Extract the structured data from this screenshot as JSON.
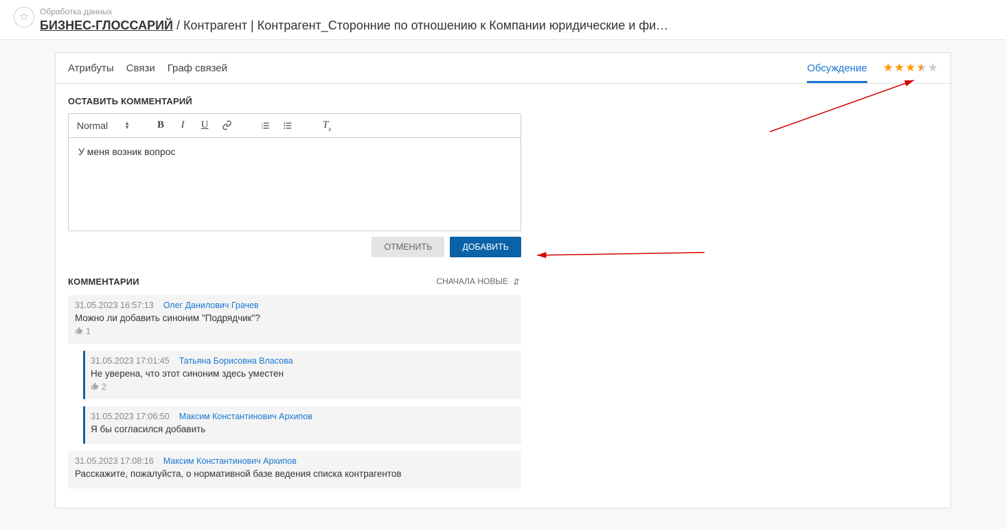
{
  "header": {
    "category": "Обработка данных",
    "root_label": "БИЗНЕС-ГЛОССАРИЙ",
    "trail": " / Контрагент | Контрагент_Сторонние по отношению к Компании юридические и фи…"
  },
  "tabs": {
    "attributes": "Атрибуты",
    "links": "Связи",
    "graph": "Граф связей",
    "discussion": "Обсуждение"
  },
  "rating": {
    "full": 3,
    "half": 1,
    "empty": 1
  },
  "compose": {
    "title": "ОСТАВИТЬ КОММЕНТАРИЙ",
    "format_label": "Normal",
    "content": "У меня возник вопрос",
    "cancel": "ОТМЕНИТЬ",
    "submit": "ДОБАВИТЬ"
  },
  "comments_section": {
    "title": "КОММЕНТАРИИ",
    "sort_label": "СНАЧАЛА НОВЫЕ"
  },
  "comments": [
    {
      "time": "31.05.2023 16:57:13",
      "author": "Олег Данилович Грачев",
      "body": "Можно ли добавить синоним \"Подрядчик\"?",
      "likes": "1",
      "reply": false
    },
    {
      "time": "31.05.2023 17:01:45",
      "author": "Татьяна Борисовна Власова",
      "body": "Не уверена, что этот синоним здесь уместен",
      "likes": "2",
      "reply": true
    },
    {
      "time": "31.05.2023 17:06:50",
      "author": "Максим Константинович Архипов",
      "body": "Я бы согласился добавить",
      "likes": "",
      "reply": true
    },
    {
      "time": "31.05.2023 17:08:16",
      "author": "Максим Константинович Архипов",
      "body": "Расскажите, пожалуйста, о нормативной базе ведения списка контрагентов",
      "likes": "",
      "reply": false
    }
  ]
}
